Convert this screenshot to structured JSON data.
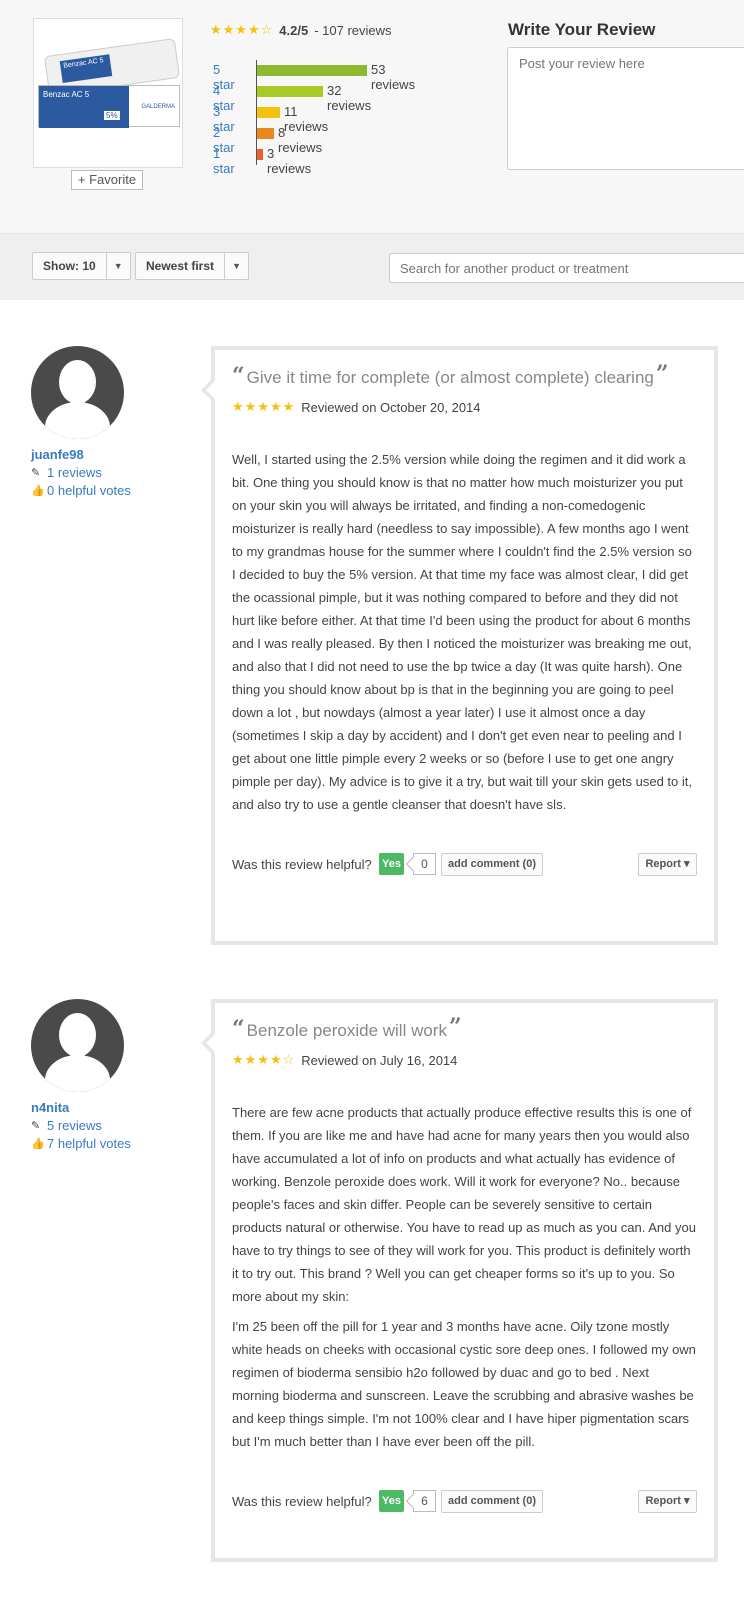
{
  "product": {
    "image_alt": "Benzac AC 5",
    "tube_label": "Benzac AC 5",
    "box_label": "Benzac AC 5",
    "box_pct": "5%",
    "box_brand": "GALDERMA",
    "favorite_label": "+ Favorite"
  },
  "summary": {
    "rating_value": 4.2,
    "stars": "★★★★",
    "star_empty": "☆",
    "rating_text": "4.2/5",
    "reviews_text": "- 107 reviews"
  },
  "distribution": [
    {
      "label": "5 star",
      "count_text": "53 reviews",
      "count": 53,
      "color": "#8db92e"
    },
    {
      "label": "4 star",
      "count_text": "32 reviews",
      "count": 32,
      "color": "#a9c926"
    },
    {
      "label": "3 star",
      "count_text": "11 reviews",
      "count": 11,
      "color": "#f4c20d"
    },
    {
      "label": "2 star",
      "count_text": "8 reviews",
      "count": 8,
      "color": "#e9891b"
    },
    {
      "label": "1 star",
      "count_text": "3 reviews",
      "count": 3,
      "color": "#e8602a"
    }
  ],
  "write_review": {
    "title": "Write Your Review",
    "placeholder": "Post your review here"
  },
  "filters": {
    "show_label": "Show: 10",
    "sort_label": "Newest first",
    "caret": "▼",
    "search_placeholder": "Search for another product or treatment"
  },
  "reviews": [
    {
      "username": "juanfe98",
      "reviews_count": "1 reviews",
      "helpful_votes": "0 helpful votes",
      "title": "Give it time for complete (or almost complete) clearing",
      "stars": "★★★★★",
      "stars_value": 5,
      "date_text": "Reviewed on October 20, 2014",
      "body": [
        "Well, I started using the 2.5% version while doing the regimen and it did work a bit. One thing you should know is that no matter how much moisturizer you put on your skin you will always be irritated, and finding a non-comedogenic moisturizer is really hard (needless to say impossible). A few months ago I went to my grandmas house for the summer where I couldn't find the 2.5% version so I decided to buy the 5% version. At that time my face was almost clear, I did get the ocassional pimple, but it was nothing compared to before and they did not hurt like before either. At that time I'd been using the product for about 6 months and I was really pleased. By then I noticed the moisturizer was breaking me out, and also that I did not need to use the bp twice a day (It was quite harsh). One thing you should know about bp is that in the beginning you are going to peel down a lot , but nowdays (almost a year later) I use it almost once a day (sometimes I skip a day by accident) and I don't get even near to peeling and I get about one little pimple every 2 weeks or so (before I use to get one angry pimple per day). My advice is to give it a try, but wait till your skin gets used to it, and also try to use a gentle cleanser that doesn't have sls."
      ],
      "helpful_label": "Was this review helpful?",
      "yes_label": "Yes",
      "vote_count": "0",
      "comment_label": "add comment (0)",
      "report_label": "Report ▾"
    },
    {
      "username": "n4nita",
      "reviews_count": "5 reviews",
      "helpful_votes": "7 helpful votes",
      "title": "Benzole peroxide will work",
      "stars": "★★★★",
      "star_empty": "☆",
      "stars_value": 4,
      "date_text": "Reviewed on July 16, 2014",
      "body": [
        "There are few acne products that actually produce effective results this is one of them. If you are like me and have had acne for many years then you would also have accumulated a lot of info on products and what actually has evidence of working. Benzole peroxide does work. Will it work for everyone? No.. because people's faces and skin differ. People can be severely sensitive to certain products natural or otherwise. You have to read up as much as you can. And you have to try things to see of they will work for you. This product is definitely worth it to try out. This brand ? Well you can get cheaper forms so it's up to you. So more about my skin:",
        "I'm 25 been off the pill for 1 year and 3 months have acne. Oily tzone mostly white heads on cheeks with occasional cystic sore deep ones. I followed my own regimen of bioderma sensibio h2o followed by duac and go to bed . Next morning bioderma and sunscreen. Leave the scrubbing and abrasive washes be and keep things simple. I'm not 100% clear and I have hiper pigmentation scars but I'm much better than I have ever been off the pill."
      ],
      "helpful_label": "Was this review helpful?",
      "yes_label": "Yes",
      "vote_count": "6",
      "comment_label": "add comment (0)",
      "report_label": "Report ▾"
    }
  ]
}
